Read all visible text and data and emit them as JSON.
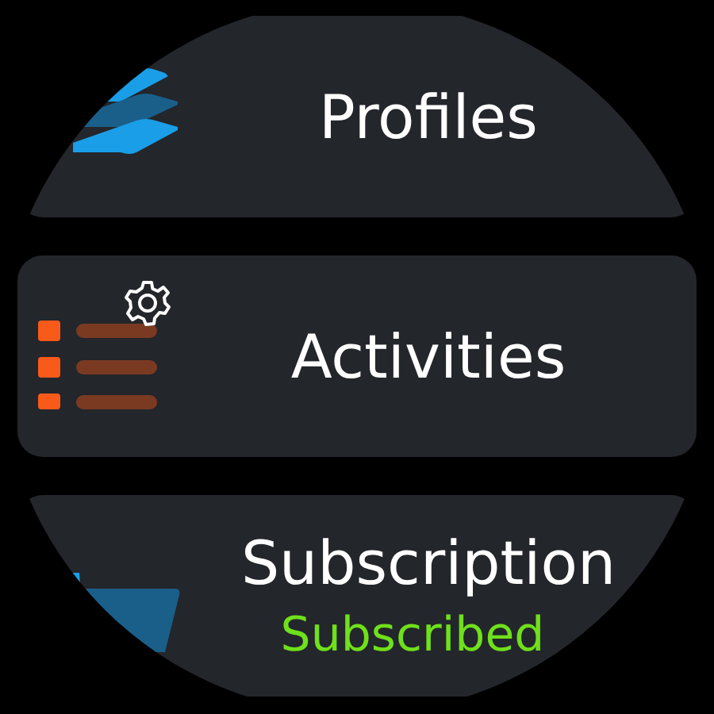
{
  "menu": [
    {
      "kind": "profiles",
      "label": "Profiles"
    },
    {
      "kind": "activities",
      "label": "Activities"
    },
    {
      "kind": "subscription",
      "label": "Subscription",
      "status": "Subscribed"
    }
  ]
}
